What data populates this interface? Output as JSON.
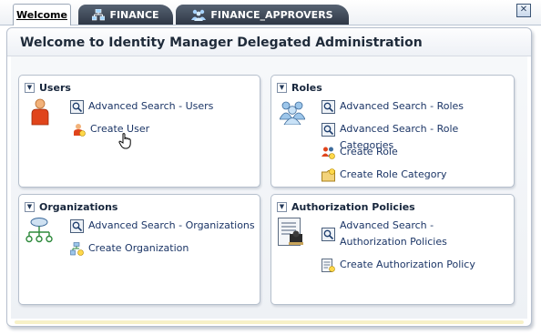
{
  "tabs": [
    {
      "label": "Welcome",
      "active": true
    },
    {
      "label": "FINANCE",
      "icon": "organization-icon"
    },
    {
      "label": "FINANCE_APPROVERS",
      "icon": "role-group-icon"
    }
  ],
  "close_icon": "close-icon",
  "page_title": "Welcome to Identity Manager Delegated Administration",
  "sections": {
    "users": {
      "title": "Users",
      "links": [
        "Advanced Search - Users",
        "Create User"
      ]
    },
    "roles": {
      "title": "Roles",
      "links": [
        "Advanced Search - Roles",
        "Advanced Search - Role Categories",
        "Create Role",
        "Create Role Category"
      ]
    },
    "organizations": {
      "title": "Organizations",
      "links": [
        "Advanced Search - Organizations",
        "Create Organization"
      ]
    },
    "authorization_policies": {
      "title": "Authorization Policies",
      "links": [
        "Advanced Search - Authorization Policies",
        "Create Authorization Policy"
      ]
    }
  },
  "colors": {
    "link": "#1b3566",
    "dark_tab": "#3a4452",
    "accent_footer": "#f7f1c8"
  }
}
